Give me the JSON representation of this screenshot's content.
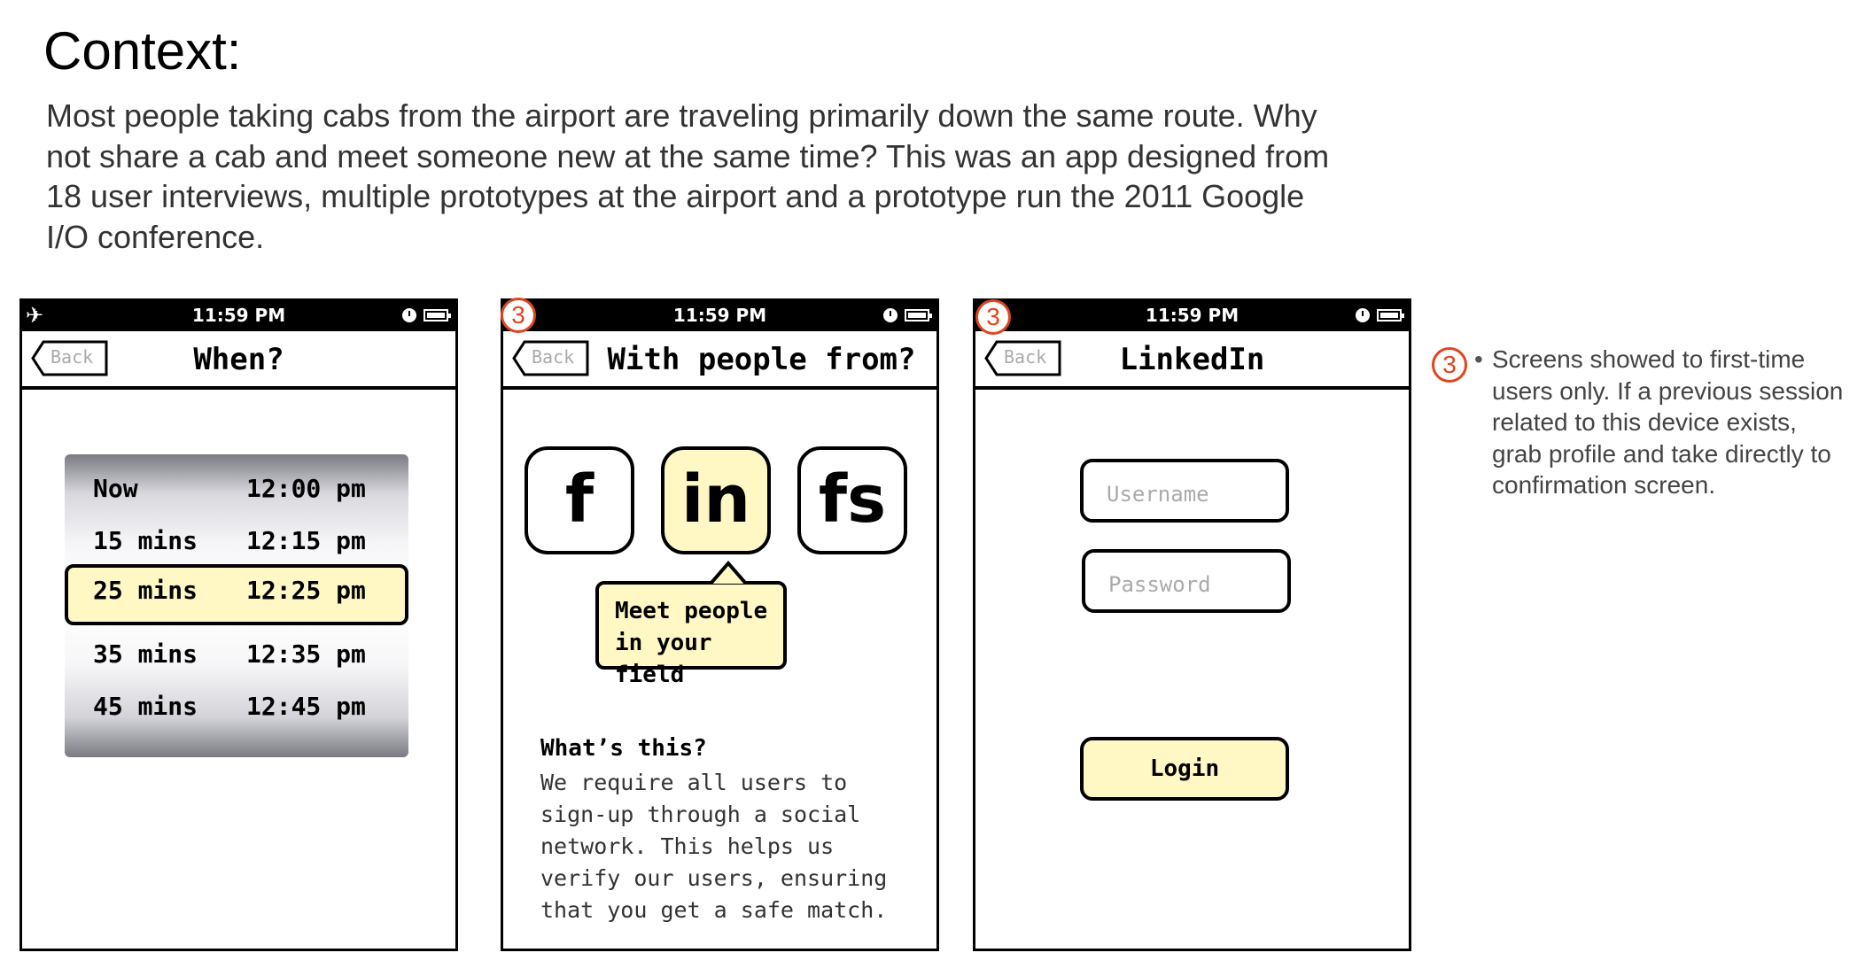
{
  "context": {
    "title": "Context:",
    "body": "Most people taking cabs from the airport are traveling primarily down the same route. Why not share a cab and meet someone new at the same time? This was an app designed from 18 user interviews, multiple prototypes at the airport and a prototype run the 2011 Google I/O conference."
  },
  "screens": [
    {
      "status_time": "11:59 PM",
      "back_label": "Back",
      "title": "When?",
      "picker_rows": [
        {
          "left": "Now",
          "right": "12:00 pm"
        },
        {
          "left": "15 mins",
          "right": "12:15 pm"
        },
        {
          "left": "25 mins",
          "right": "12:25 pm"
        },
        {
          "left": "35 mins",
          "right": "12:35 pm"
        },
        {
          "left": "45 mins",
          "right": "12:45 pm"
        }
      ],
      "selected_index": 2
    },
    {
      "status_time": "11:59 PM",
      "badge": "3",
      "back_label": "Back",
      "title": "With people from?",
      "social": [
        "f",
        "in",
        "fs"
      ],
      "tooltip": [
        "Meet people",
        "in your field"
      ],
      "whats_title": "What’s this?",
      "whats_body": "We require all users to sign-up through a social network. This helps us verify our users, ensuring that you get a safe match."
    },
    {
      "status_time": "11:59 PM",
      "badge": "3",
      "back_label": "Back",
      "title": "LinkedIn",
      "username_placeholder": "Username",
      "password_placeholder": "Password",
      "login_label": "Login"
    }
  ],
  "note": {
    "badge": "3",
    "bullet": "•",
    "text": "Screens showed to first-time users only. If a previous session related to this device exists, grab profile and take directly to confirmation screen."
  },
  "colors": {
    "highlight": "#fff8c4",
    "badge": "#e0451f"
  }
}
